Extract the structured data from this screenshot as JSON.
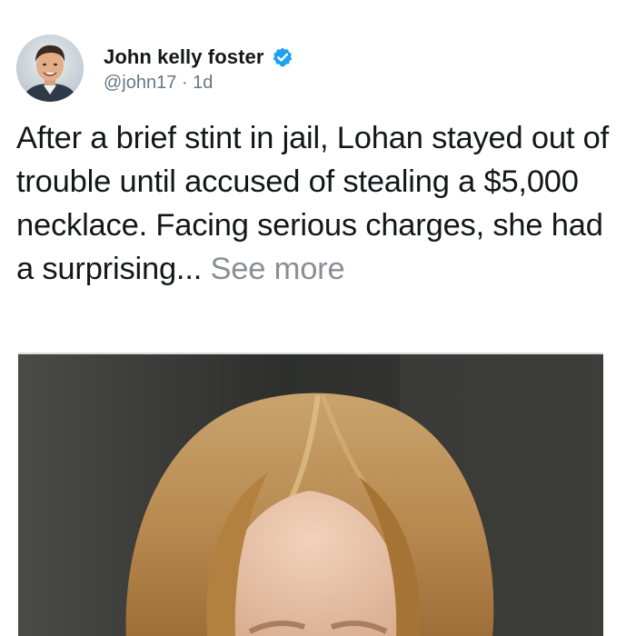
{
  "tweet": {
    "author": {
      "display_name": "John kelly foster",
      "handle": "@john17",
      "separator": "·",
      "time_ago": "1d",
      "verified": true,
      "avatar_icon": "person-avatar"
    },
    "text": "After a brief stint in jail, Lohan stayed out of trouble until accused of stealing a $5,000 necklace. Facing serious charges, she had a surprising...",
    "see_more_label": "See more",
    "media": {
      "type": "photo",
      "icon": "person-photo"
    }
  },
  "colors": {
    "text_primary": "#14171a",
    "text_secondary": "#657786",
    "see_more": "#8a8f94",
    "verified_badge": "#1da1f2"
  }
}
